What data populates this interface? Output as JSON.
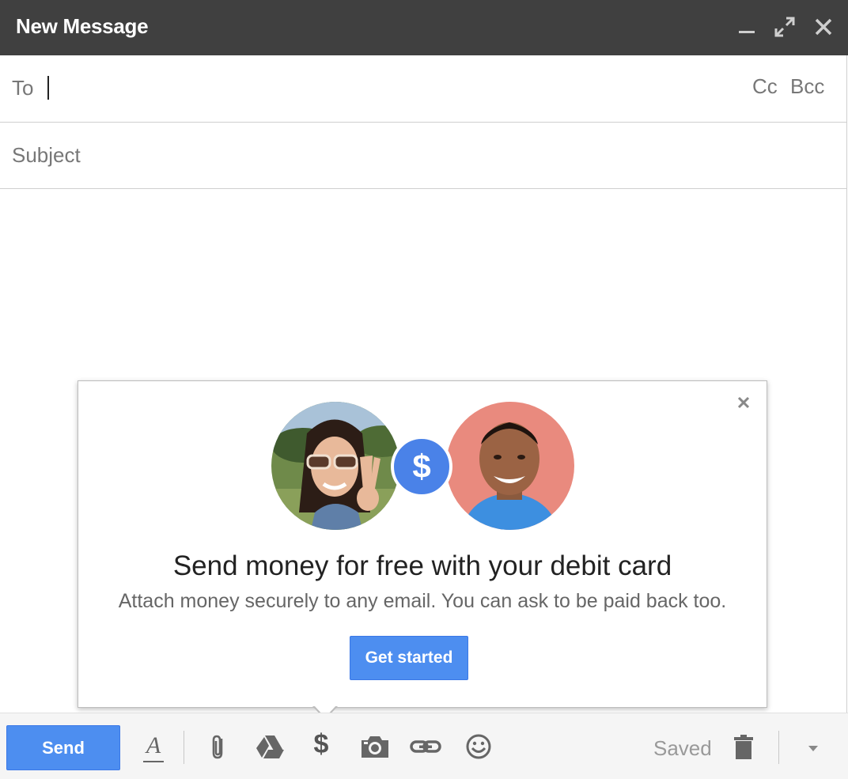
{
  "window": {
    "title": "New Message"
  },
  "compose": {
    "to_label": "To",
    "cc_label": "Cc",
    "bcc_label": "Bcc",
    "subject_placeholder": "Subject"
  },
  "promo": {
    "heading": "Send money for free with your debit card",
    "subtext": "Attach money securely to any email. You can ask to be paid back too.",
    "button_label": "Get started",
    "badge_symbol": "$"
  },
  "toolbar": {
    "send_label": "Send",
    "format_label": "A",
    "money_label": "$",
    "status": "Saved",
    "icons": [
      "formatting-icon",
      "attach-icon",
      "drive-icon",
      "money-icon",
      "photo-icon",
      "link-icon",
      "emoji-icon",
      "trash-icon",
      "more-options-icon"
    ]
  },
  "colors": {
    "titlebar": "#404040",
    "accent_blue": "#4d8ef0",
    "badge_blue": "#4a82e8"
  }
}
